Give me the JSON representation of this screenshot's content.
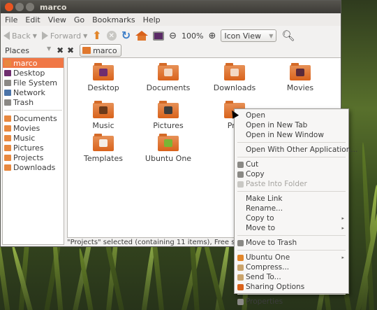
{
  "window": {
    "title": "marco"
  },
  "menubar": {
    "items": [
      "File",
      "Edit",
      "View",
      "Go",
      "Bookmarks",
      "Help"
    ]
  },
  "toolbar": {
    "back_label": "Back",
    "forward_label": "Forward",
    "zoom_level": "100%",
    "view_mode": "Icon View"
  },
  "sidebar": {
    "header": "Places",
    "items": [
      {
        "label": "marco",
        "icon": "home-folder-icon",
        "selected": true
      },
      {
        "label": "Desktop",
        "icon": "desktop-icon"
      },
      {
        "label": "File System",
        "icon": "drive-icon"
      },
      {
        "label": "Network",
        "icon": "network-icon"
      },
      {
        "label": "Trash",
        "icon": "trash-icon"
      },
      {
        "label": "Documents",
        "icon": "folder-icon"
      },
      {
        "label": "Movies",
        "icon": "folder-icon"
      },
      {
        "label": "Music",
        "icon": "folder-icon"
      },
      {
        "label": "Pictures",
        "icon": "folder-icon"
      },
      {
        "label": "Projects",
        "icon": "folder-icon"
      },
      {
        "label": "Downloads",
        "icon": "folder-icon"
      }
    ]
  },
  "pathbar": {
    "crumb": "marco"
  },
  "files": [
    {
      "label": "Desktop",
      "icon": "desktop-folder-icon"
    },
    {
      "label": "Documents",
      "icon": "documents-folder-icon"
    },
    {
      "label": "Downloads",
      "icon": "downloads-folder-icon"
    },
    {
      "label": "Movies",
      "icon": "movies-folder-icon"
    },
    {
      "label": "Music",
      "icon": "music-folder-icon"
    },
    {
      "label": "Pictures",
      "icon": "pictures-folder-icon"
    },
    {
      "label": "Proj",
      "icon": "folder-icon"
    },
    {
      "label": "Templates",
      "icon": "templates-folder-icon"
    },
    {
      "label": "Ubuntu One",
      "icon": "ubuntu-one-folder-icon"
    }
  ],
  "status": "\"Projects\" selected (containing 11 items), Free space: 253.1",
  "context_menu": {
    "items": [
      {
        "label": "Open"
      },
      {
        "label": "Open in New Tab"
      },
      {
        "label": "Open in New Window"
      },
      {
        "sep": true
      },
      {
        "label": "Open With Other Application..."
      },
      {
        "sep": true
      },
      {
        "label": "Cut",
        "icon": "cut-icon"
      },
      {
        "label": "Copy",
        "icon": "copy-icon"
      },
      {
        "label": "Paste Into Folder",
        "icon": "paste-icon",
        "disabled": true
      },
      {
        "sep": true
      },
      {
        "label": "Make Link"
      },
      {
        "label": "Rename..."
      },
      {
        "label": "Copy to",
        "submenu": true
      },
      {
        "label": "Move to",
        "submenu": true
      },
      {
        "sep": true
      },
      {
        "label": "Move to Trash",
        "icon": "trash-icon"
      },
      {
        "sep": true
      },
      {
        "label": "Ubuntu One",
        "icon": "ubuntu-one-icon",
        "submenu": true
      },
      {
        "label": "Compress...",
        "icon": "compress-icon"
      },
      {
        "label": "Send To...",
        "icon": "send-to-icon"
      },
      {
        "label": "Sharing Options",
        "icon": "sharing-icon"
      },
      {
        "sep": true
      },
      {
        "label": "Properties",
        "icon": "properties-icon"
      }
    ]
  },
  "colors": {
    "accent": "#e95420",
    "folder": "#d9621b",
    "selection": "#f07746"
  }
}
